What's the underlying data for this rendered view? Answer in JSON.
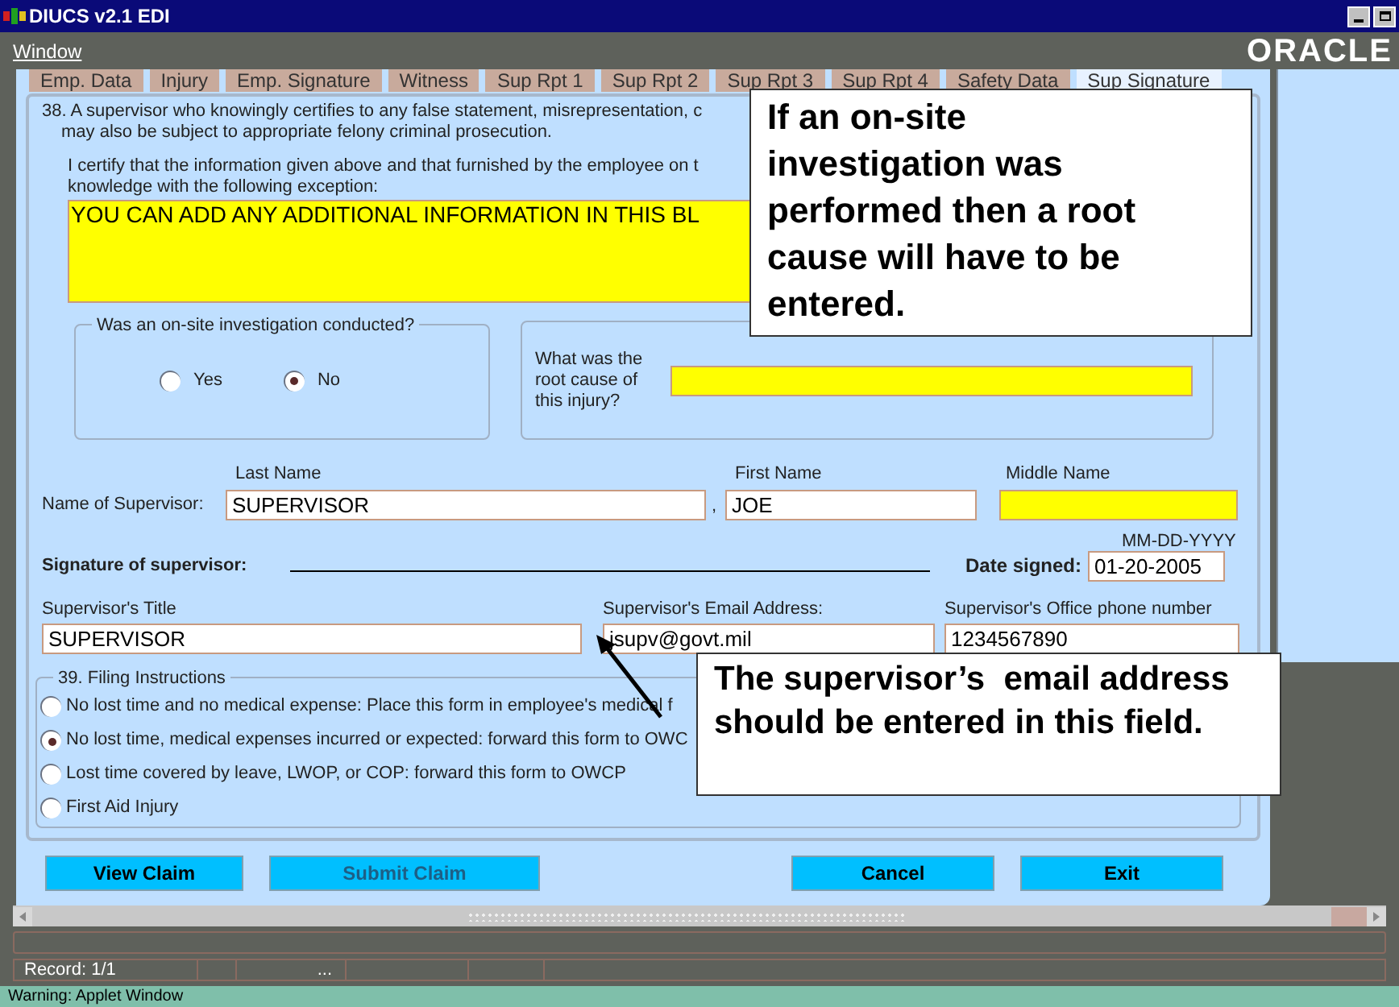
{
  "window": {
    "title": "DIUCS v2.1 EDI"
  },
  "menu": [
    "Window"
  ],
  "logo": "ORACLE",
  "tabs": [
    {
      "label": "Emp. Data",
      "selected": false
    },
    {
      "label": "Injury",
      "selected": false
    },
    {
      "label": "Emp. Signature",
      "selected": false
    },
    {
      "label": "Witness",
      "selected": false
    },
    {
      "label": "Sup Rpt 1",
      "selected": false
    },
    {
      "label": "Sup Rpt 2",
      "selected": false
    },
    {
      "label": "Sup Rpt 3",
      "selected": false
    },
    {
      "label": "Sup Rpt 4",
      "selected": false
    },
    {
      "label": "Safety Data",
      "selected": false
    },
    {
      "label": "Sup Signature",
      "selected": true
    }
  ],
  "certification": {
    "statement_lines": [
      "38. A supervisor who knowingly certifies to any false statement, misrepresentation, c",
      "may also be subject to appropriate felony criminal prosecution."
    ],
    "exception_lines": [
      "I certify that the information given above and that furnished by the employee on t",
      "knowledge with the following exception:"
    ],
    "exception_value": "YOU CAN ADD ANY ADDITIONAL INFORMATION IN THIS BL"
  },
  "investigation": {
    "legend": "Was an on-site investigation conducted?",
    "options": [
      {
        "label": "Yes",
        "selected": false
      },
      {
        "label": "No",
        "selected": true
      }
    ]
  },
  "root_cause": {
    "label": "What was the root cause of this injury?",
    "required": true
  },
  "name": {
    "row_label": "Name of Supervisor:",
    "separator": ",",
    "fields": [
      {
        "label": "Last Name",
        "value": "SUPERVISOR",
        "required": false
      },
      {
        "label": "First Name",
        "value": "JOE",
        "required": false
      },
      {
        "label": "Middle Name",
        "required": true
      }
    ]
  },
  "signature": {
    "label": "Signature of supervisor:",
    "date_label": "Date signed:",
    "date_format": "MM-DD-YYYY",
    "date_value": "01-20-2005"
  },
  "contact_fields": [
    {
      "label": "Supervisor's Title",
      "value": "SUPERVISOR"
    },
    {
      "label": "Supervisor's Email Address:",
      "value": "jsupv@govt.mil"
    },
    {
      "label": "Supervisor's Office phone number",
      "value": "1234567890"
    }
  ],
  "filing": {
    "legend": "39. Filing Instructions",
    "options": [
      {
        "label": "No lost time and no medical expense:  Place this form in employee's medical f",
        "selected": false
      },
      {
        "label": "No lost time, medical expenses incurred or expected:  forward this form to OWC",
        "selected": true
      },
      {
        "label": "Lost time covered by leave, LWOP, or COP:  forward this form to OWCP",
        "selected": false
      },
      {
        "label": "First Aid Injury",
        "selected": false
      }
    ]
  },
  "buttons": [
    {
      "label": "View Claim",
      "disabled": false
    },
    {
      "label": "Submit Claim",
      "disabled": true
    },
    {
      "label": "Cancel",
      "disabled": false
    },
    {
      "label": "Exit",
      "disabled": false
    }
  ],
  "status_bar": {
    "record": "Record: 1/1",
    "field_4": "..."
  },
  "warning": "Warning: Applet Window",
  "callouts": [
    "If an on-site investigation was performed then a root cause will have to be entered.",
    "The supervisor’s  email address should be entered in this field."
  ]
}
